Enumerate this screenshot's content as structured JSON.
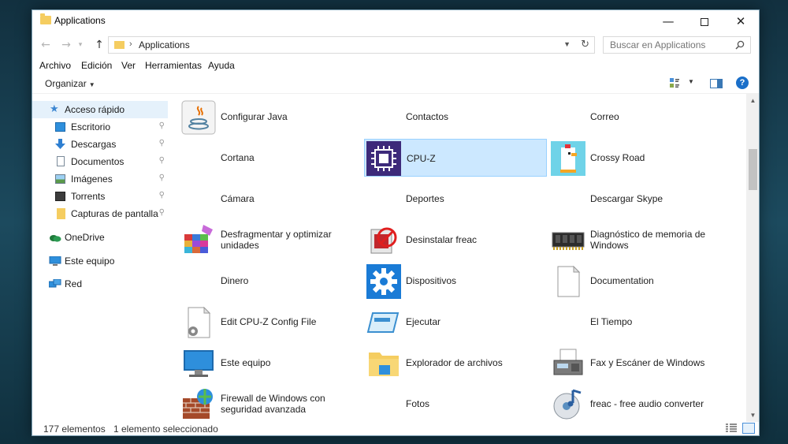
{
  "window": {
    "title": "Applications",
    "controls": {
      "minimize": "—",
      "close": "✕"
    }
  },
  "address": {
    "path": "Applications",
    "search_placeholder": "Buscar en Applications"
  },
  "menu": [
    "Archivo",
    "Edición",
    "Ver",
    "Herramientas",
    "Ayuda"
  ],
  "toolbar": {
    "organize": "Organizar"
  },
  "navpane": {
    "quick_access": "Acceso rápido",
    "pinned": [
      "Escritorio",
      "Descargas",
      "Documentos",
      "Imágenes",
      "Torrents",
      "Capturas de pantalla"
    ],
    "onedrive": "OneDrive",
    "this_pc": "Este equipo",
    "network": "Red"
  },
  "items": [
    {
      "label": "Configurar Java",
      "icon": "java-icon"
    },
    {
      "label": "Contactos",
      "icon": ""
    },
    {
      "label": "Correo",
      "icon": ""
    },
    {
      "label": "Cortana",
      "icon": ""
    },
    {
      "label": "CPU-Z",
      "icon": "cpu-z-icon",
      "selected": true
    },
    {
      "label": "Crossy Road",
      "icon": "crossy-road-icon"
    },
    {
      "label": "Cámara",
      "icon": ""
    },
    {
      "label": "Deportes",
      "icon": ""
    },
    {
      "label": "Descargar Skype",
      "icon": ""
    },
    {
      "label": "Desfragmentar y optimizar unidades",
      "icon": "defrag-icon"
    },
    {
      "label": "Desinstalar freac",
      "icon": "uninstall-icon"
    },
    {
      "label": "Diagnóstico de memoria de Windows",
      "icon": "memory-chip-icon"
    },
    {
      "label": "Dinero",
      "icon": ""
    },
    {
      "label": "Dispositivos",
      "icon": "gear-icon"
    },
    {
      "label": "Documentation",
      "icon": "document-icon"
    },
    {
      "label": "Edit CPU-Z Config File",
      "icon": "config-file-icon"
    },
    {
      "label": "Ejecutar",
      "icon": "run-icon"
    },
    {
      "label": "El Tiempo",
      "icon": ""
    },
    {
      "label": "Este equipo",
      "icon": "computer-icon"
    },
    {
      "label": "Explorador de archivos",
      "icon": "folder-icon"
    },
    {
      "label": "Fax y Escáner de Windows",
      "icon": "fax-icon"
    },
    {
      "label": "Firewall de Windows con seguridad avanzada",
      "icon": "firewall-icon"
    },
    {
      "label": "Fotos",
      "icon": ""
    },
    {
      "label": "freac - free audio converter",
      "icon": "freac-icon"
    }
  ],
  "status": {
    "count": "177 elementos",
    "selection": "1 elemento seleccionado"
  },
  "colors": {
    "selection_bg": "#cce8ff",
    "selection_border": "#99d1ff",
    "folder_yellow": "#f5cd60",
    "accent_blue": "#1a6fc9"
  }
}
